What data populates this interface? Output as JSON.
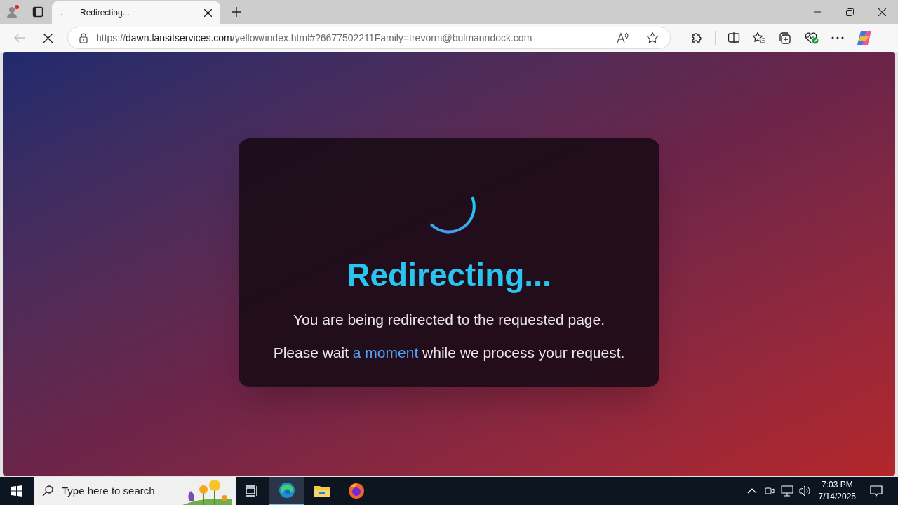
{
  "browser": {
    "tabs": [
      {
        "favicon": ".",
        "title": "Redirecting...",
        "selected": true
      }
    ],
    "url": "https://**dawn.lansitservices.com**/yellow/index.html#?6677502211Family=trevorm@bulmanndock.com"
  },
  "page": {
    "heading": "Redirecting...",
    "message": "You are being redirected to the requested page.",
    "note": "Please wait **a moment** while we process your request."
  },
  "taskbar": {
    "search": {
      "placeholder": "Type here to search"
    },
    "time": "7:03 PM",
    "date": "7/14/2025"
  }
}
